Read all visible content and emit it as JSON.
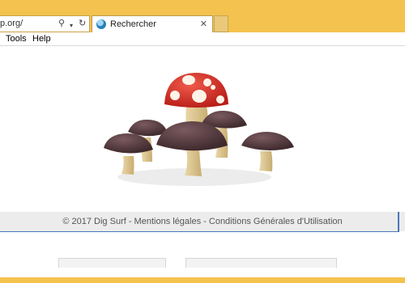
{
  "browser": {
    "address_text": "p.org/",
    "tab_title": "Rechercher"
  },
  "menu": {
    "items": [
      {
        "label": "Tools"
      },
      {
        "label": "Help"
      }
    ]
  },
  "page": {
    "footer_text": "© 2017 Dig Surf - Mentions légales - Conditions Générales d'Utilisation"
  },
  "colors": {
    "chrome_accent": "#f4c24e",
    "search_border": "#4a78b8"
  }
}
